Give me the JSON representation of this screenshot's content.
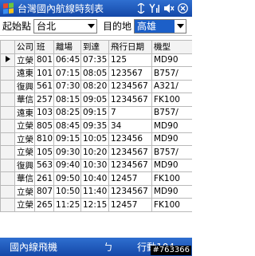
{
  "titlebar": {
    "title": "台灣國內航線時刻表",
    "battery_glyph": "⏷",
    "signal_glyph": "Y",
    "volume_glyph": "◀×",
    "ok_label": "ok"
  },
  "form": {
    "origin_label": "起始點",
    "origin_value": "台北",
    "destination_label": "目的地",
    "destination_value": "高雄"
  },
  "table": {
    "columns": [
      "公司",
      "班",
      "離場",
      "到達",
      "飛行日期",
      "機型"
    ],
    "rows": [
      [
        "立榮",
        "801",
        "06:45",
        "07:35",
        "125",
        "MD90"
      ],
      [
        "遠東",
        "101",
        "07:15",
        "08:05",
        "123567",
        "B757/"
      ],
      [
        "復興",
        "561",
        "07:30",
        "08:20",
        "1234567",
        "A321/"
      ],
      [
        "華信",
        "257",
        "08:15",
        "09:05",
        "1234567",
        "FK100"
      ],
      [
        "遠東",
        "103",
        "08:25",
        "09:15",
        "7",
        "B757/"
      ],
      [
        "立榮",
        "805",
        "08:45",
        "09:35",
        "34",
        "MD90"
      ],
      [
        "立榮",
        "810",
        "09:15",
        "10:05",
        "123456",
        "MD90"
      ],
      [
        "立榮",
        "105",
        "09:30",
        "10:20",
        "1234567",
        "B757/"
      ],
      [
        "復興",
        "563",
        "09:40",
        "10:30",
        "1234567",
        "MD90"
      ],
      [
        "華信",
        "261",
        "09:50",
        "10:40",
        "12457",
        "FK100"
      ],
      [
        "立榮",
        "807",
        "10:50",
        "11:40",
        "1234567",
        "MD90"
      ],
      [
        "立榮",
        "265",
        "11:25",
        "12:15",
        "12457",
        "FK100"
      ]
    ]
  },
  "bottombar": {
    "left_label": "國內線飛機",
    "mid_label": "ㄅ",
    "right_label": "行動104"
  },
  "watermark": "#763366",
  "colors": {
    "bar": "#1a55b8",
    "highlight": "#1c5fc8"
  }
}
